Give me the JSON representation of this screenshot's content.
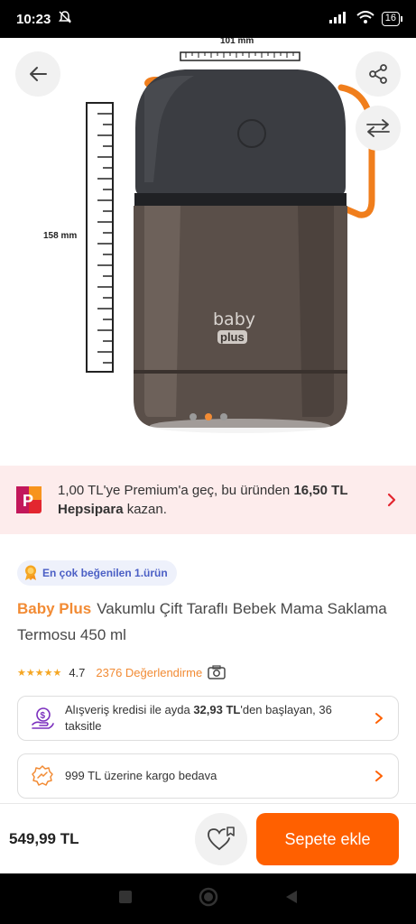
{
  "status_bar": {
    "time": "10:23",
    "battery": "16"
  },
  "product_image": {
    "width_label": "101 mm",
    "height_label": "158 mm",
    "logo_top": "baby",
    "logo_bottom": "plus",
    "dots_count": 3,
    "active_dot": 1
  },
  "promo": {
    "text_part1": "1,00 TL'ye Premium'a geç, bu üründen ",
    "text_bold": "16,50 TL Hepsipara",
    "text_part2": " kazan."
  },
  "badge": {
    "label": "En çok beğenilen 1.ürün"
  },
  "product": {
    "brand": "Baby Plus",
    "name": "Vakumlu Çift Taraflı Bebek Mama Saklama Termosu 450 ml"
  },
  "rating": {
    "stars": "★★★★★",
    "value": "4.7",
    "reviews_label": "2376 Değerlendirme"
  },
  "installment": {
    "text_part1": "Alışveriş kredisi ile ayda ",
    "text_bold": "32,93 TL",
    "text_part2": "'den başlayan, 36 taksitle"
  },
  "shipping": {
    "text": "999 TL üzerine kargo bedava"
  },
  "bottom_bar": {
    "price": "549,99 TL",
    "cart_label": "Sepete ekle"
  },
  "colors": {
    "accent": "#ff6000",
    "brand": "#f28b34",
    "badge_text": "#4b5fc5"
  }
}
